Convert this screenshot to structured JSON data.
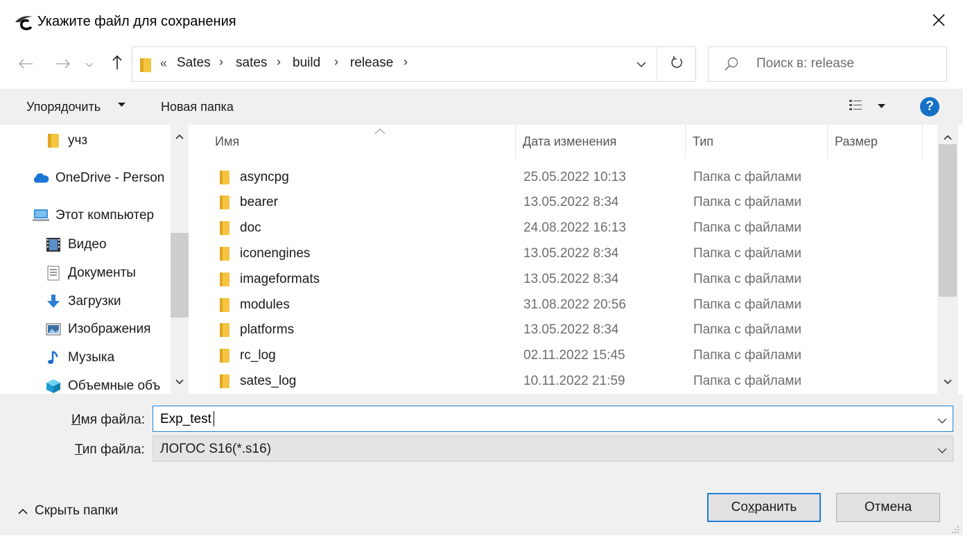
{
  "window": {
    "title": "Укажите файл для сохранения",
    "close_glyph": "✕"
  },
  "navigation": {
    "back_icon": "arrow-left-icon",
    "forward_icon": "arrow-right-icon",
    "up_icon": "arrow-up-icon",
    "overflow": "«",
    "breadcrumbs": [
      "Sates",
      "sates",
      "build",
      "release"
    ],
    "separator": "›"
  },
  "search": {
    "placeholder": "Поиск в: release"
  },
  "toolbar": {
    "organize_label": "Упорядочить",
    "new_folder_label": "Новая папка",
    "help_label": "?"
  },
  "nav_pane": {
    "items": [
      {
        "label": "учз",
        "icon": "folder-icon"
      },
      {
        "label": "OneDrive - Person",
        "icon": "onedrive-cloud-icon"
      },
      {
        "label": "Этот компьютер",
        "icon": "computer-icon"
      },
      {
        "label": "Видео",
        "icon": "video-icon"
      },
      {
        "label": "Документы",
        "icon": "documents-icon"
      },
      {
        "label": "Загрузки",
        "icon": "downloads-icon"
      },
      {
        "label": "Изображения",
        "icon": "pictures-icon"
      },
      {
        "label": "Музыка",
        "icon": "music-icon"
      },
      {
        "label": "Объемные объ",
        "icon": "3d-objects-icon"
      }
    ]
  },
  "file_list": {
    "columns": [
      "Имя",
      "Дата изменения",
      "Тип",
      "Размер"
    ],
    "rows": [
      {
        "name": "asyncpg",
        "date": "25.05.2022 10:13",
        "type": "Папка с файлами"
      },
      {
        "name": "bearer",
        "date": "13.05.2022 8:34",
        "type": "Папка с файлами"
      },
      {
        "name": "doc",
        "date": "24.08.2022 16:13",
        "type": "Папка с файлами"
      },
      {
        "name": "iconengines",
        "date": "13.05.2022 8:34",
        "type": "Папка с файлами"
      },
      {
        "name": "imageformats",
        "date": "13.05.2022 8:34",
        "type": "Папка с файлами"
      },
      {
        "name": "modules",
        "date": "31.08.2022 20:56",
        "type": "Папка с файлами"
      },
      {
        "name": "platforms",
        "date": "13.05.2022 8:34",
        "type": "Папка с файлами"
      },
      {
        "name": "rc_log",
        "date": "02.11.2022 15:45",
        "type": "Папка с файлами"
      },
      {
        "name": "sates_log",
        "date": "10.11.2022 21:59",
        "type": "Папка с файлами"
      }
    ]
  },
  "form": {
    "filename_label_pre": "",
    "filename_label_u": "И",
    "filename_label_post": "мя файла:",
    "filename_value": "Exp_test",
    "filetype_label_u": "Т",
    "filetype_label_post": "ип файла:",
    "filetype_value": "ЛОГОС S16(*.s16)"
  },
  "footer": {
    "hide_folders_label": "Скрыть папки",
    "save_label_pre": "Со",
    "save_label_u": "х",
    "save_label_post": "ранить",
    "cancel_label": "Отмена"
  },
  "colors": {
    "accent": "#1e7fd6",
    "folder": "#f5c542",
    "help": "#1570c8"
  }
}
